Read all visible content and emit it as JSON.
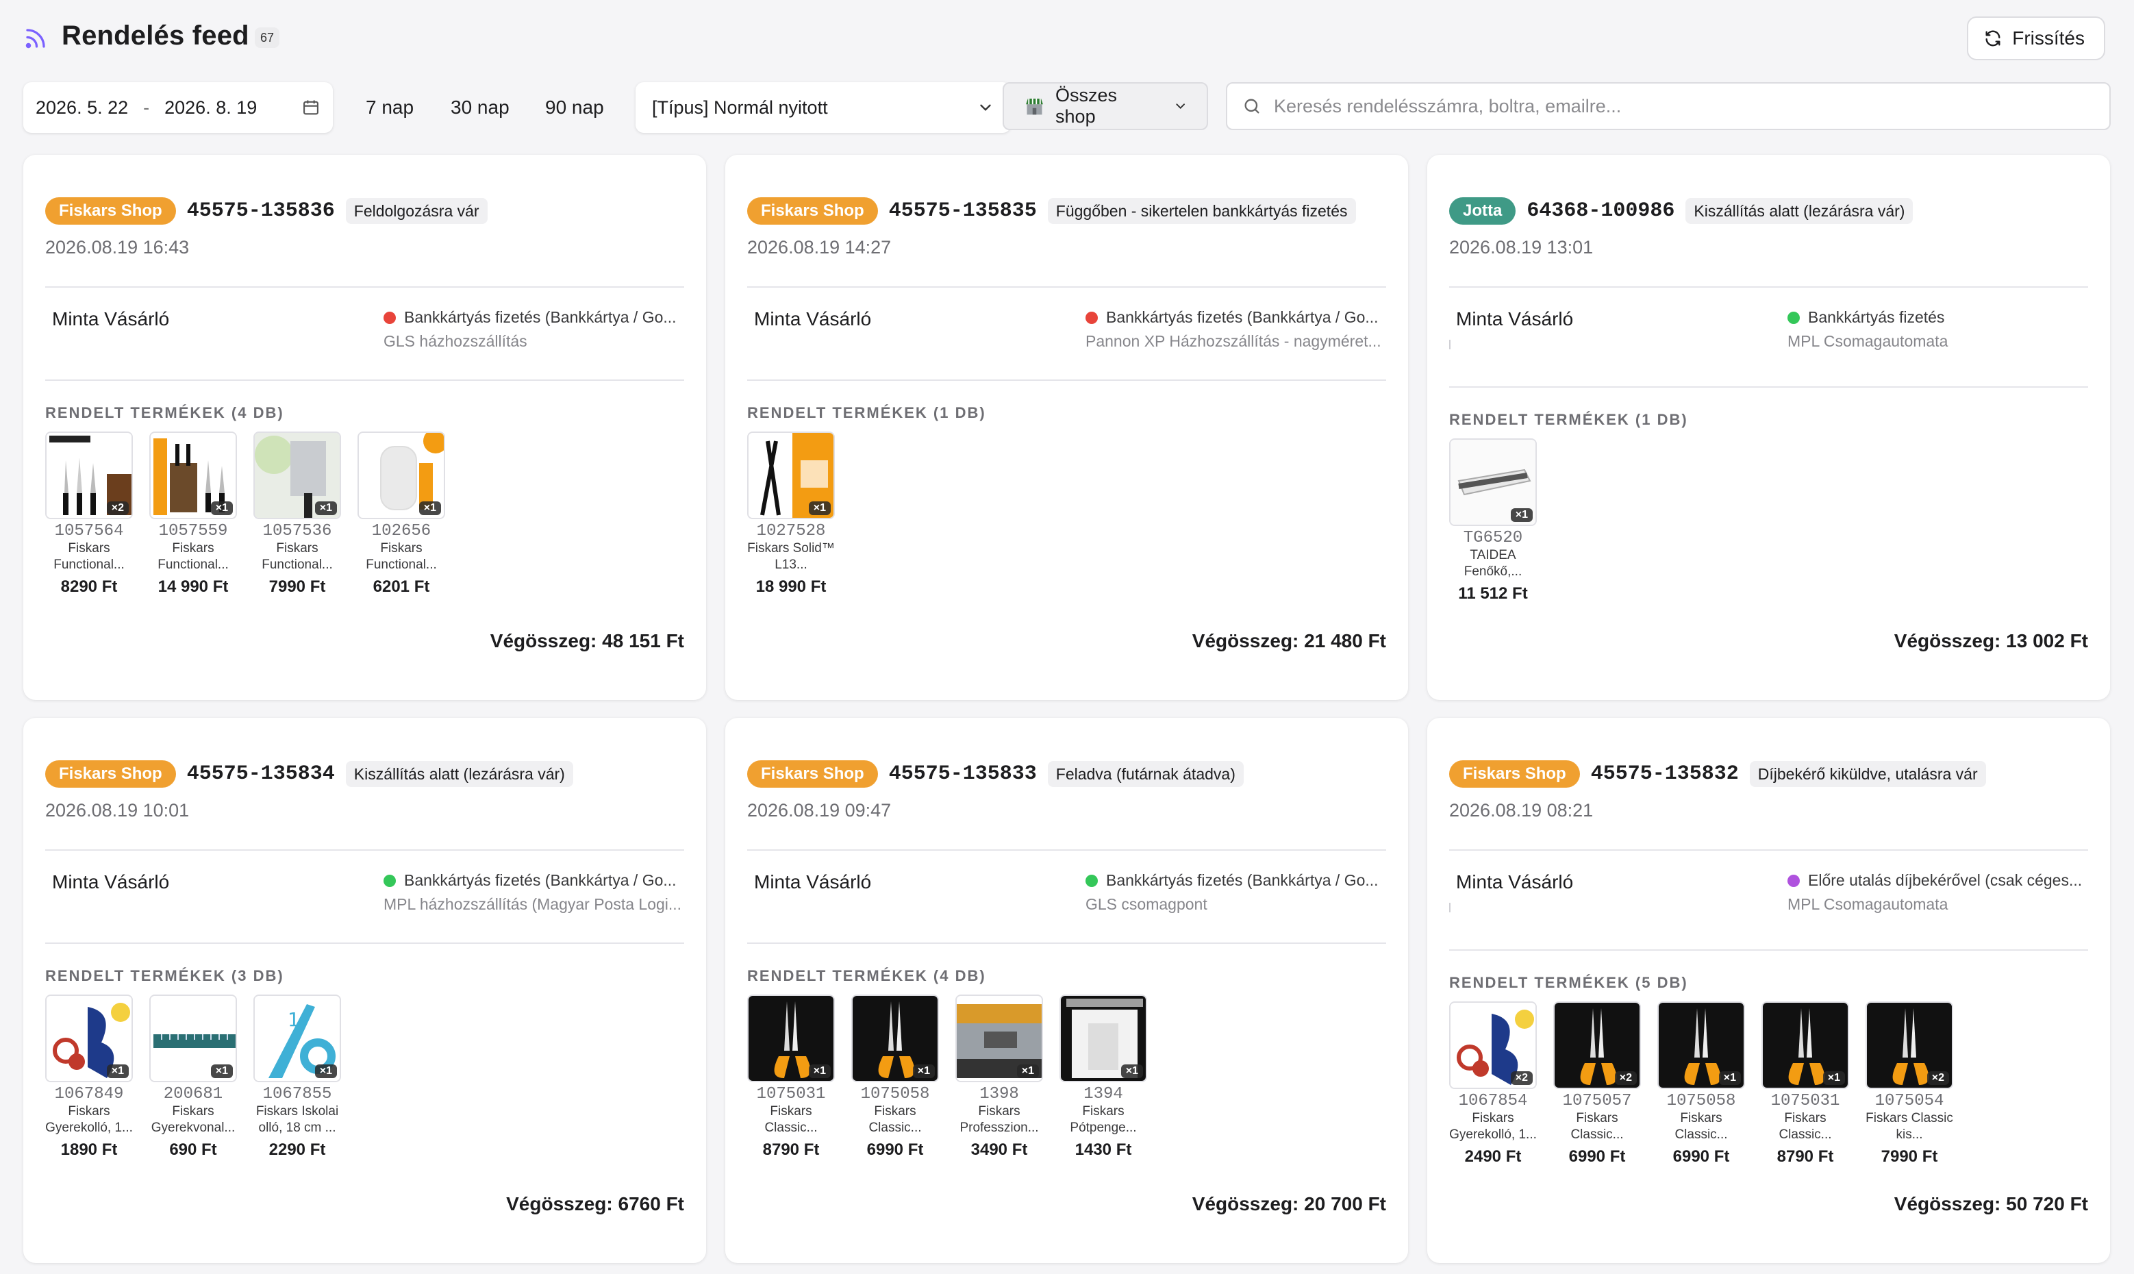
{
  "header": {
    "title": "Rendelés feed",
    "count": "67",
    "refresh_label": "Frissítés"
  },
  "filters": {
    "date_from": "2026. 5. 22",
    "date_to": "2026. 8. 19",
    "date_sep": "-",
    "quick": [
      "7 nap",
      "30 nap",
      "90 nap"
    ],
    "type_value": "[Típus] Normál nyitott",
    "shop_value": "Összes shop",
    "search_placeholder": "Keresés rendelésszámra, boltra, emailre..."
  },
  "colors": {
    "fiskars": "#f0a030",
    "jotta": "#3f9a86",
    "dot_red": "#e8443a",
    "dot_green": "#34c759",
    "dot_purple": "#af52de"
  },
  "orders": [
    {
      "shop": "Fiskars Shop",
      "shop_color": "#f0a030",
      "order_no": "45575-135836",
      "status": "Feldolgozásra vár",
      "date": "2026.08.19 16:43",
      "customer": "Minta Vásárló",
      "payment": "Bankkártyás fizetés (Bankkártya / Go...",
      "dot": "#e8443a",
      "shipping": "GLS házhozszállítás",
      "products_label": "RENDELT TERMÉKEK (4 DB)",
      "products": [
        {
          "sku": "1057564",
          "name": "Fiskars Functional...",
          "price": "8290 Ft",
          "qty": "×2",
          "img": "knives-set"
        },
        {
          "sku": "1057559",
          "name": "Fiskars Functional...",
          "price": "14 990 Ft",
          "qty": "×1",
          "img": "knife-block"
        },
        {
          "sku": "1057536",
          "name": "Fiskars Functional...",
          "price": "7990 Ft",
          "qty": "×1",
          "img": "cleaver"
        },
        {
          "sku": "102656",
          "name": "Fiskars Functional...",
          "price": "6201 Ft",
          "qty": "×1",
          "img": "sharpener"
        }
      ],
      "total": "Végösszeg: 48 151 Ft"
    },
    {
      "shop": "Fiskars Shop",
      "shop_color": "#f0a030",
      "order_no": "45575-135835",
      "status": "Függőben - sikertelen bankkártyás fizetés",
      "date": "2026.08.19 14:27",
      "customer": "Minta Vásárló",
      "payment": "Bankkártyás fizetés (Bankkártya / Go...",
      "dot": "#e8443a",
      "shipping": "Pannon XP Házhozszállítás - nagyméret...",
      "products_label": "RENDELT TERMÉKEK (1 DB)",
      "products": [
        {
          "sku": "1027528",
          "name": "Fiskars Solid™ L13...",
          "price": "18 990 Ft",
          "qty": "×1",
          "img": "lopper"
        }
      ],
      "total": "Végösszeg: 21 480 Ft"
    },
    {
      "shop": "Jotta",
      "shop_color": "#3f9a86",
      "order_no": "64368-100986",
      "status": "Kiszállítás alatt (lezárásra vár)",
      "date": "2026.08.19 13:01",
      "customer": "Minta Vásárló",
      "payment": "Bankkártyás fizetés",
      "dot": "#34c759",
      "shipping": "MPL Csomagautomata",
      "products_label": "RENDELT TERMÉKEK (1 DB)",
      "products": [
        {
          "sku": "TG6520",
          "name": "TAIDEA Fenőkő,...",
          "price": "11 512 Ft",
          "qty": "×1",
          "img": "whetstone"
        }
      ],
      "total": "Végösszeg: 13 002 Ft"
    },
    {
      "shop": "Fiskars Shop",
      "shop_color": "#f0a030",
      "order_no": "45575-135834",
      "status": "Kiszállítás alatt (lezárásra vár)",
      "date": "2026.08.19 10:01",
      "customer": "Minta Vásárló",
      "payment": "Bankkártyás fizetés (Bankkártya / Go...",
      "dot": "#34c759",
      "shipping": "MPL házhozszállítás (Magyar Posta Logi...",
      "products_label": "RENDELT TERMÉKEK (3 DB)",
      "products": [
        {
          "sku": "1067849",
          "name": "Fiskars Gyerekolló, 1...",
          "price": "1890 Ft",
          "qty": "×1",
          "img": "kids-scissors-blue"
        },
        {
          "sku": "200681",
          "name": "Fiskars Gyerekvonal...",
          "price": "690 Ft",
          "qty": "×1",
          "img": "ruler"
        },
        {
          "sku": "1067855",
          "name": "Fiskars Iskolai olló, 18 cm ...",
          "price": "2290 Ft",
          "qty": "×1",
          "img": "school-scissors"
        }
      ],
      "total": "Végösszeg: 6760 Ft"
    },
    {
      "shop": "Fiskars Shop",
      "shop_color": "#f0a030",
      "order_no": "45575-135833",
      "status": "Feladva (futárnak átadva)",
      "date": "2026.08.19 09:47",
      "customer": "Minta Vásárló",
      "payment": "Bankkártyás fizetés (Bankkártya / Go...",
      "dot": "#34c759",
      "shipping": "GLS csomagpont",
      "products_label": "RENDELT TERMÉKEK (4 DB)",
      "products": [
        {
          "sku": "1075031",
          "name": "Fiskars Classic...",
          "price": "8790 Ft",
          "qty": "×1",
          "img": "classic-scissors"
        },
        {
          "sku": "1075058",
          "name": "Fiskars Classic...",
          "price": "6990 Ft",
          "qty": "×1",
          "img": "classic-scissors"
        },
        {
          "sku": "1398",
          "name": "Fiskars Professzion...",
          "price": "3490 Ft",
          "qty": "×1",
          "img": "cutter"
        },
        {
          "sku": "1394",
          "name": "Fiskars Pótpenge...",
          "price": "1430 Ft",
          "qty": "×1",
          "img": "blade-pack"
        }
      ],
      "total": "Végösszeg: 20 700 Ft"
    },
    {
      "shop": "Fiskars Shop",
      "shop_color": "#f0a030",
      "order_no": "45575-135832",
      "status": "Díjbekérő kiküldve, utalásra vár",
      "date": "2026.08.19 08:21",
      "customer": "Minta Vásárló",
      "payment": "Előre utalás díjbekérővel (csak céges...",
      "dot": "#af52de",
      "shipping": "MPL Csomagautomata",
      "products_label": "RENDELT TERMÉKEK (5 DB)",
      "products": [
        {
          "sku": "1067854",
          "name": "Fiskars Gyerekolló, 1...",
          "price": "2490 Ft",
          "qty": "×2",
          "img": "kids-scissors-blue"
        },
        {
          "sku": "1075057",
          "name": "Fiskars Classic...",
          "price": "6990 Ft",
          "qty": "×2",
          "img": "classic-scissors"
        },
        {
          "sku": "1075058",
          "name": "Fiskars Classic...",
          "price": "6990 Ft",
          "qty": "×1",
          "img": "classic-scissors"
        },
        {
          "sku": "1075031",
          "name": "Fiskars Classic...",
          "price": "8790 Ft",
          "qty": "×1",
          "img": "classic-scissors"
        },
        {
          "sku": "1075054",
          "name": "Fiskars Classic kis...",
          "price": "7990 Ft",
          "qty": "×2",
          "img": "classic-scissors"
        }
      ],
      "total": "Végösszeg: 50 720 Ft"
    }
  ]
}
